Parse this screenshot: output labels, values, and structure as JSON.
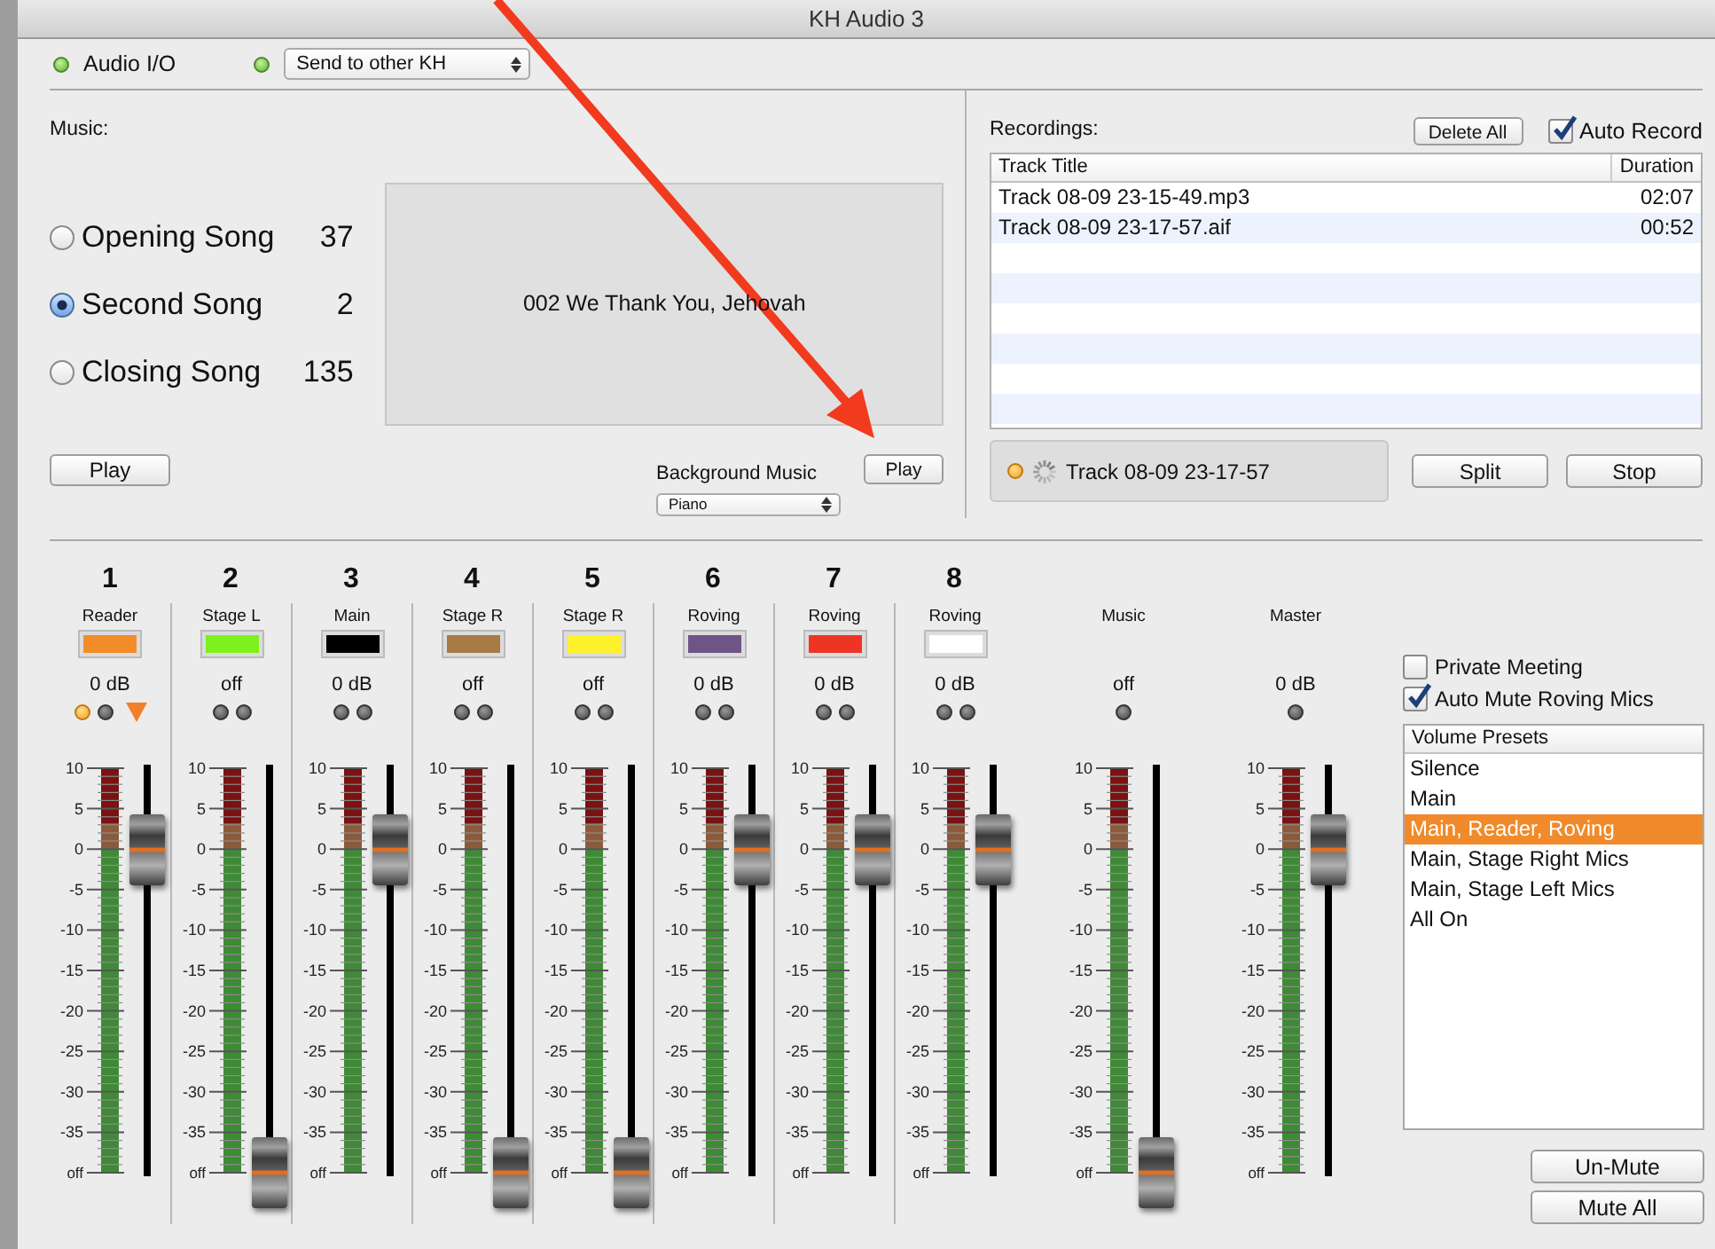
{
  "window": {
    "title": "KH Audio 3"
  },
  "toolbar": {
    "audio_io": {
      "label": "Audio I/O",
      "on": true
    },
    "send": {
      "on": true,
      "value": "Send to other KH"
    }
  },
  "music": {
    "label": "Music:",
    "songs": [
      {
        "name": "Opening Song",
        "number": "37",
        "selected": false
      },
      {
        "name": "Second Song",
        "number": "2",
        "selected": true
      },
      {
        "name": "Closing Song",
        "number": "135",
        "selected": false
      }
    ],
    "now_playing": "002 We Thank You, Jehovah",
    "play_button": "Play",
    "background_music": {
      "label": "Background Music",
      "play_button": "Play",
      "value": "Piano"
    }
  },
  "recordings": {
    "label": "Recordings:",
    "delete_button": "Delete All",
    "auto_record": {
      "label": "Auto Record",
      "checked": true
    },
    "columns": [
      "Track Title",
      "Duration"
    ],
    "rows": [
      {
        "title": "Track 08-09 23-15-49.mp3",
        "duration": "02:07"
      },
      {
        "title": "Track 08-09 23-17-57.aif",
        "duration": "00:52"
      }
    ],
    "status": {
      "recording": true,
      "text": "Track 08-09 23-17-57"
    },
    "split_button": "Split",
    "stop_button": "Stop"
  },
  "mixer": {
    "channels": [
      {
        "kind": "input",
        "number": "1",
        "name": "Reader",
        "color": "#f28c28",
        "reading": "0 dB",
        "leds": [
          {
            "on": true
          },
          {
            "on": false
          }
        ],
        "flagged": true,
        "level": 0.8,
        "scale": [
          "10",
          "5",
          "0",
          "-5",
          "-10",
          "-15",
          "-20",
          "-25",
          "-30",
          "-35",
          "off"
        ]
      },
      {
        "kind": "input",
        "number": "2",
        "name": "Stage L",
        "color": "#7cf21a",
        "reading": "off",
        "leds": [
          {
            "on": false
          },
          {
            "on": false
          }
        ],
        "flagged": false,
        "level": 0,
        "scale": [
          "10",
          "5",
          "0",
          "-5",
          "-10",
          "-15",
          "-20",
          "-25",
          "-30",
          "-35",
          "off"
        ]
      },
      {
        "kind": "input",
        "number": "3",
        "name": "Main",
        "color": "#000000",
        "reading": "0 dB",
        "leds": [
          {
            "on": false
          },
          {
            "on": false
          }
        ],
        "flagged": false,
        "level": 0.8,
        "scale": [
          "10",
          "5",
          "0",
          "-5",
          "-10",
          "-15",
          "-20",
          "-25",
          "-30",
          "-35",
          "off"
        ]
      },
      {
        "kind": "input",
        "number": "4",
        "name": "Stage R",
        "color": "#a87a45",
        "reading": "off",
        "leds": [
          {
            "on": false
          },
          {
            "on": false
          }
        ],
        "flagged": false,
        "level": 0,
        "scale": [
          "10",
          "5",
          "0",
          "-5",
          "-10",
          "-15",
          "-20",
          "-25",
          "-30",
          "-35",
          "off"
        ]
      },
      {
        "kind": "input",
        "number": "5",
        "name": "Stage R",
        "color": "#fff22a",
        "reading": "off",
        "leds": [
          {
            "on": false
          },
          {
            "on": false
          }
        ],
        "flagged": false,
        "level": 0,
        "scale": [
          "10",
          "5",
          "0",
          "-5",
          "-10",
          "-15",
          "-20",
          "-25",
          "-30",
          "-35",
          "off"
        ]
      },
      {
        "kind": "input",
        "number": "6",
        "name": "Roving",
        "color": "#6e5585",
        "reading": "0 dB",
        "leds": [
          {
            "on": false
          },
          {
            "on": false
          }
        ],
        "flagged": false,
        "level": 0.8,
        "scale": [
          "10",
          "5",
          "0",
          "-5",
          "-10",
          "-15",
          "-20",
          "-25",
          "-30",
          "-35",
          "off"
        ]
      },
      {
        "kind": "input",
        "number": "7",
        "name": "Roving",
        "color": "#ee3524",
        "reading": "0 dB",
        "leds": [
          {
            "on": false
          },
          {
            "on": false
          }
        ],
        "flagged": false,
        "level": 0.8,
        "scale": [
          "10",
          "5",
          "0",
          "-5",
          "-10",
          "-15",
          "-20",
          "-25",
          "-30",
          "-35",
          "off"
        ]
      },
      {
        "kind": "input",
        "number": "8",
        "name": "Roving",
        "color": "#ffffff",
        "reading": "0 dB",
        "leds": [
          {
            "on": false
          },
          {
            "on": false
          }
        ],
        "flagged": false,
        "level": 0.8,
        "scale": [
          "10",
          "5",
          "0",
          "-5",
          "-10",
          "-15",
          "-20",
          "-25",
          "-30",
          "-35",
          "off"
        ]
      },
      {
        "kind": "bus",
        "name": "Music",
        "reading": "off",
        "leds": [
          {
            "on": false
          }
        ],
        "flagged": false,
        "level": 0,
        "scale": [
          "10",
          "5",
          "0",
          "-5",
          "-10",
          "-15",
          "-20",
          "-25",
          "-30",
          "-35",
          "off"
        ]
      },
      {
        "kind": "bus",
        "name": "Master",
        "reading": "0 dB",
        "leds": [
          {
            "on": false
          }
        ],
        "flagged": false,
        "level": 0.8,
        "scale": [
          "10",
          "5",
          "0",
          "-5",
          "-10",
          "-15",
          "-20",
          "-25",
          "-30",
          "-35",
          "off"
        ]
      }
    ]
  },
  "options": [
    {
      "label": "Private Meeting",
      "checked": false
    },
    {
      "label": "Auto Mute Roving Mics",
      "checked": true
    }
  ],
  "presets": {
    "header": "Volume Presets",
    "items": [
      {
        "label": "Silence",
        "selected": false
      },
      {
        "label": "Main",
        "selected": false
      },
      {
        "label": "Main, Reader, Roving",
        "selected": true
      },
      {
        "label": "Main, Stage Right Mics",
        "selected": false
      },
      {
        "label": "Main, Stage Left Mics",
        "selected": false
      },
      {
        "label": "All On",
        "selected": false
      }
    ]
  },
  "buttons": [
    "Un-Mute",
    "Mute All"
  ]
}
